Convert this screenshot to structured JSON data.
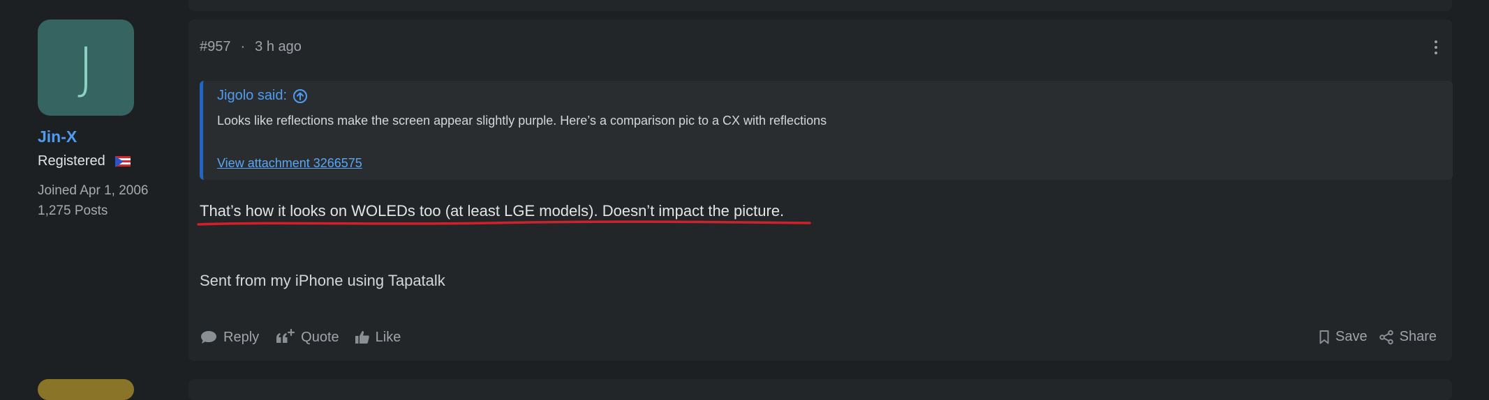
{
  "author": {
    "avatar_letter": "J",
    "avatar_color": "#366461",
    "username": "Jin-X",
    "role": "Registered",
    "joined": "Joined Apr 1, 2006",
    "posts": "1,275 Posts",
    "flag_icon": "puerto-rico-flag-icon"
  },
  "post": {
    "number": "#957",
    "separator": "·",
    "time": "3 h ago",
    "quote": {
      "author": "Jigolo said:",
      "text": "Looks like reflections make the screen appear slightly purple. Here’s a comparison pic to a CX with reflections",
      "attachment_link": "View attachment 3266575"
    },
    "body": "That’s how it looks on WOLEDs too (at least LGE models). Doesn’t impact the picture.",
    "signature": "Sent from my iPhone using Tapatalk"
  },
  "actions": {
    "reply": "Reply",
    "quote": "Quote",
    "like": "Like",
    "save": "Save",
    "share": "Share"
  },
  "colors": {
    "background": "#1c2022",
    "card": "#232628",
    "accent": "#4f9cf2",
    "quote_border": "#2266c4",
    "annotation_red": "#d0202a"
  }
}
